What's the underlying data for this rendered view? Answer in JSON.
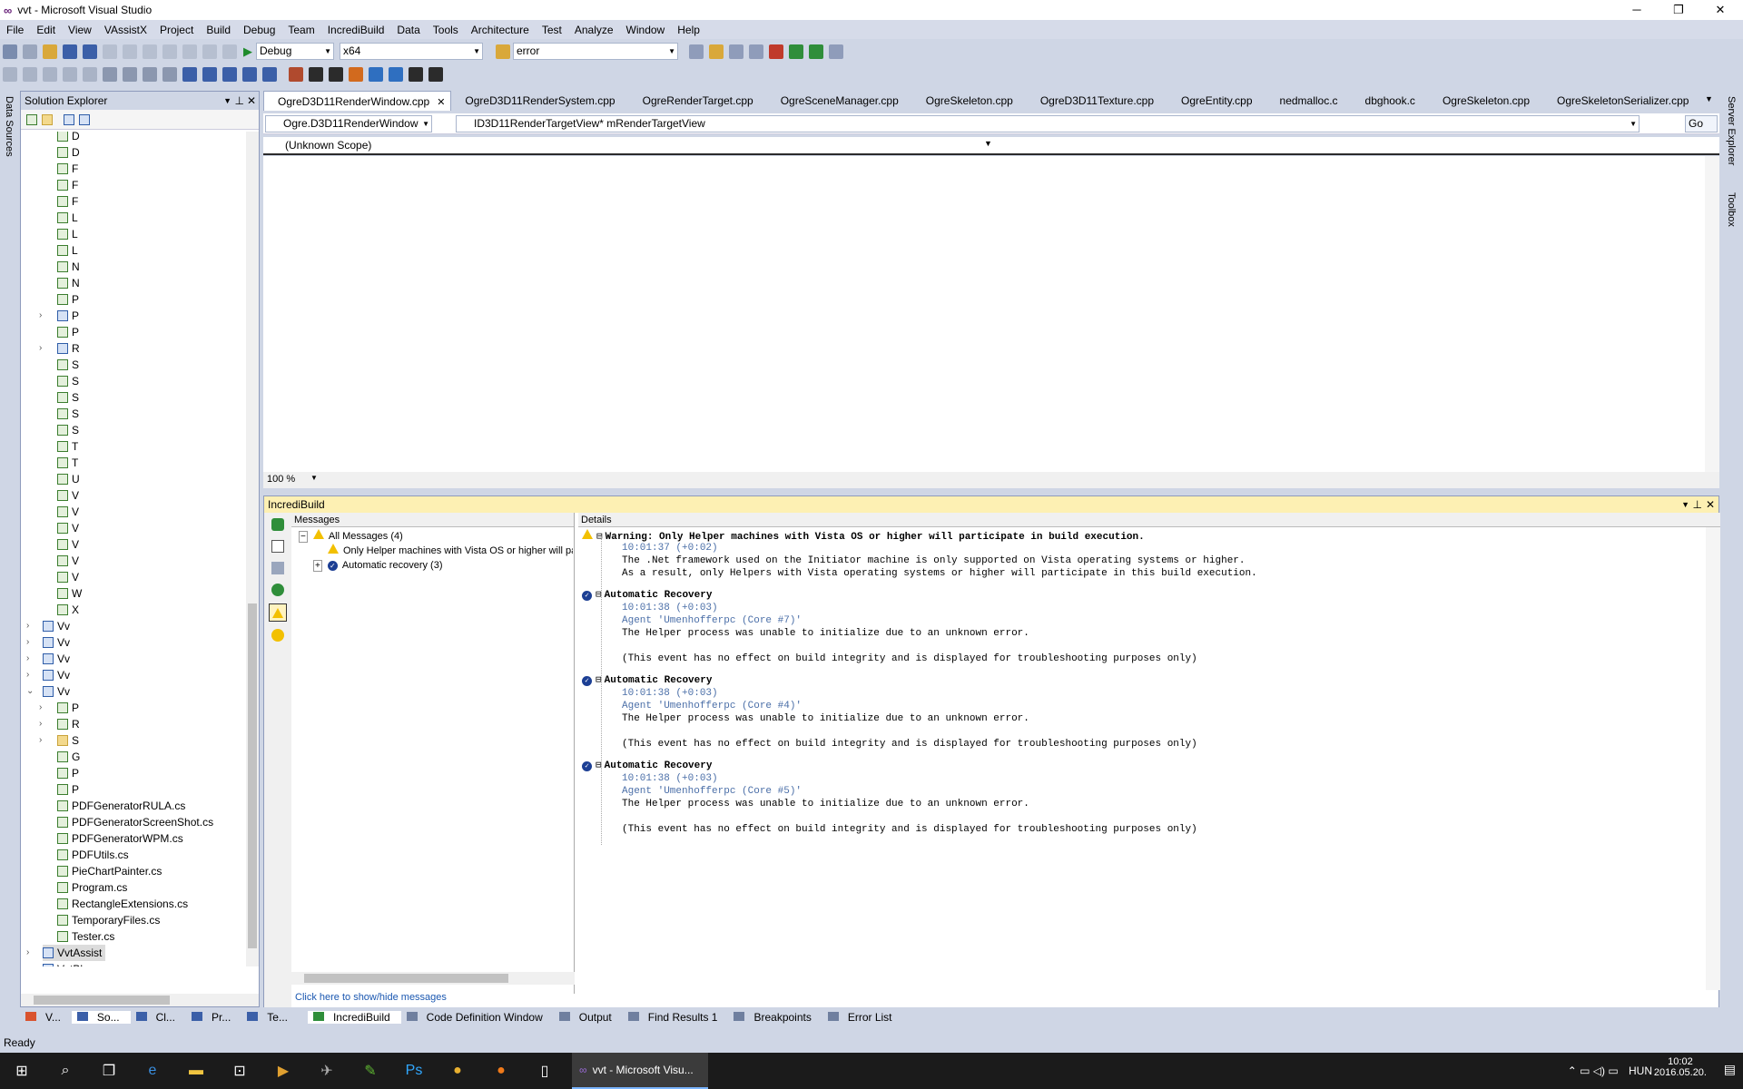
{
  "window": {
    "title": "vvt - Microsoft Visual Studio",
    "logo": "∞"
  },
  "menu": [
    "File",
    "Edit",
    "View",
    "VAssistX",
    "Project",
    "Build",
    "Debug",
    "Team",
    "IncrediBuild",
    "Data",
    "Tools",
    "Architecture",
    "Test",
    "Analyze",
    "Window",
    "Help"
  ],
  "toolbar": {
    "config": "Debug",
    "platform": "x64",
    "find": "error"
  },
  "left_strip": {
    "label": "Data Sources"
  },
  "right_strip": {
    "label1": "Server Explorer",
    "label2": "Toolbox"
  },
  "solution_explorer": {
    "title": "Solution Explorer",
    "items": [
      {
        "label": "D",
        "kind": "file"
      },
      {
        "label": "D",
        "kind": "file"
      },
      {
        "label": "F",
        "kind": "file"
      },
      {
        "label": "F",
        "kind": "file"
      },
      {
        "label": "F",
        "kind": "file"
      },
      {
        "label": "L",
        "kind": "file"
      },
      {
        "label": "L",
        "kind": "file"
      },
      {
        "label": "L",
        "kind": "file"
      },
      {
        "label": "N",
        "kind": "file"
      },
      {
        "label": "N",
        "kind": "file"
      },
      {
        "label": "P",
        "kind": "file"
      },
      {
        "label": "P",
        "kind": "proj"
      },
      {
        "label": "P",
        "kind": "file"
      },
      {
        "label": "R",
        "kind": "proj"
      },
      {
        "label": "S",
        "kind": "file"
      },
      {
        "label": "S",
        "kind": "file"
      },
      {
        "label": "S",
        "kind": "file"
      },
      {
        "label": "S",
        "kind": "file"
      },
      {
        "label": "S",
        "kind": "file"
      },
      {
        "label": "T",
        "kind": "file"
      },
      {
        "label": "T",
        "kind": "file"
      },
      {
        "label": "U",
        "kind": "file"
      },
      {
        "label": "V",
        "kind": "file"
      },
      {
        "label": "V",
        "kind": "file"
      },
      {
        "label": "V",
        "kind": "file"
      },
      {
        "label": "V",
        "kind": "file"
      },
      {
        "label": "V",
        "kind": "file"
      },
      {
        "label": "V",
        "kind": "file"
      },
      {
        "label": "W",
        "kind": "file"
      },
      {
        "label": "X",
        "kind": "file"
      }
    ],
    "projects": [
      "Vv",
      "Vv",
      "Vv",
      "Vv",
      "Vv"
    ],
    "sub_items": [
      "P",
      "R",
      "S",
      "G",
      "P",
      "P"
    ],
    "files": [
      "PDFGeneratorRULA.cs",
      "PDFGeneratorScreenShot.cs",
      "PDFGeneratorWPM.cs",
      "PDFUtils.cs",
      "PieChartPainter.cs",
      "Program.cs",
      "RectangleExtensions.cs",
      "TemporaryFiles.cs",
      "Tester.cs"
    ],
    "selected": "VvtAssist",
    "last": "VvtBl"
  },
  "tabs": [
    "OgreD3D11RenderWindow.cpp",
    "OgreD3D11RenderSystem.cpp",
    "OgreRenderTarget.cpp",
    "OgreSceneManager.cpp",
    "OgreSkeleton.cpp",
    "OgreD3D11Texture.cpp",
    "OgreEntity.cpp",
    "nedmalloc.c",
    "dbghook.c",
    "OgreSkeleton.cpp",
    "OgreSkeletonSerializer.cpp"
  ],
  "navbar": {
    "scope": "Ogre.D3D11RenderWindow",
    "member": "ID3D11RenderTargetView* mRenderTargetView",
    "go": "Go",
    "unknown_scope": "(Unknown Scope)"
  },
  "zoom": "100 %",
  "incredibuild": {
    "title": "IncrediBuild",
    "messages_header": "Messages",
    "details_header": "Details",
    "tree": [
      {
        "label": "All Messages (4)",
        "icon": "warning"
      },
      {
        "label": "Only Helper machines with Vista OS or higher will partic",
        "icon": "warning"
      },
      {
        "label": "Automatic recovery (3)",
        "icon": "info"
      }
    ],
    "footer": "Click here to show/hide messages",
    "details": [
      {
        "title": "Warning: Only Helper machines with Vista OS or higher will participate in build execution.",
        "icon": "warning",
        "time": "10:01:37 (+0:02)",
        "agent": "",
        "lines": [
          "The .Net framework used on the Initiator machine is only supported on Vista operating systems or higher.",
          "As a result, only Helpers with Vista operating systems or higher will participate in this build execution."
        ]
      },
      {
        "title": "Automatic Recovery",
        "icon": "info",
        "time": "10:01:38 (+0:03)",
        "agent": "Agent 'Umenhofferpc (Core #7)'",
        "lines": [
          "The Helper process was unable to initialize due to an unknown error.",
          "",
          "(This event has no effect on build integrity and is displayed for troubleshooting purposes only)"
        ]
      },
      {
        "title": "Automatic Recovery",
        "icon": "info",
        "time": "10:01:38 (+0:03)",
        "agent": "Agent 'Umenhofferpc (Core #4)'",
        "lines": [
          "The Helper process was unable to initialize due to an unknown error.",
          "",
          "(This event has no effect on build integrity and is displayed for troubleshooting purposes only)"
        ]
      },
      {
        "title": "Automatic Recovery",
        "icon": "info",
        "time": "10:01:38 (+0:03)",
        "agent": "Agent 'Umenhofferpc (Core #5)'",
        "lines": [
          "The Helper process was unable to initialize due to an unknown error.",
          "",
          "(This event has no effect on build integrity and is displayed for troubleshooting purposes only)"
        ]
      }
    ]
  },
  "bottom_tabs_left": [
    "V...",
    "So...",
    "Cl...",
    "Pr...",
    "Te..."
  ],
  "bottom_tabs": [
    "IncrediBuild",
    "Code Definition Window",
    "Output",
    "Find Results 1",
    "Breakpoints",
    "Error List"
  ],
  "status": "Ready",
  "taskbar": {
    "active_app": "vvt - Microsoft Visu...",
    "lang": "HUN",
    "time": "10:02",
    "date": "2016.05.20."
  }
}
